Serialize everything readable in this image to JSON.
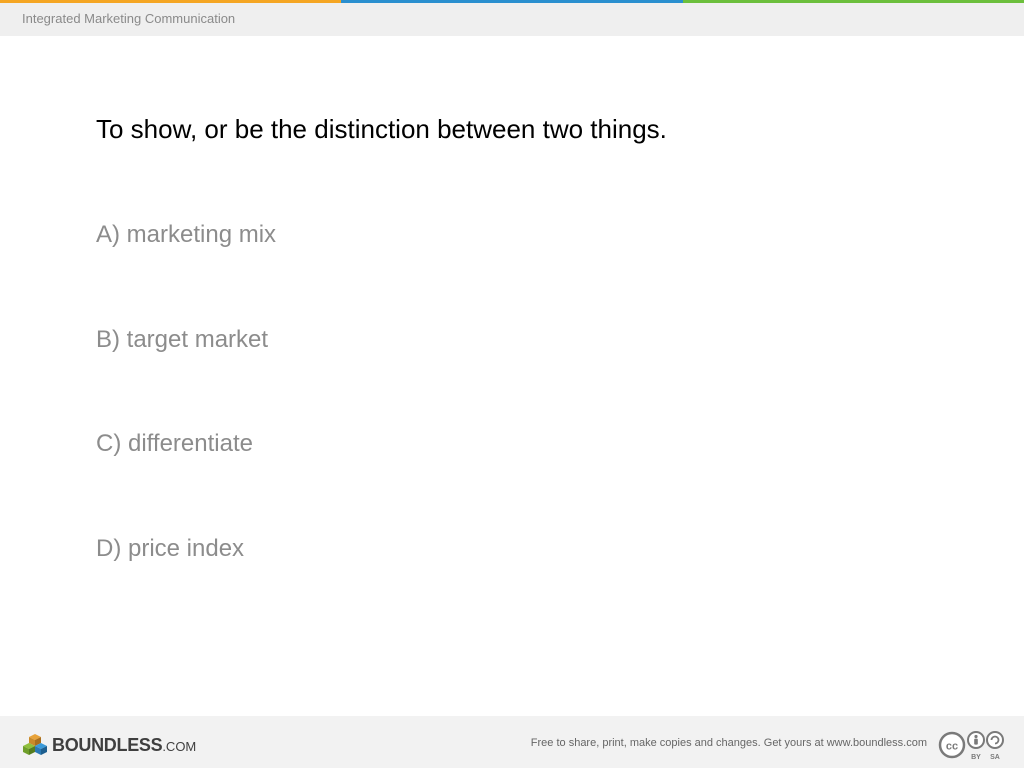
{
  "header": {
    "title": "Integrated Marketing Communication",
    "stripe_colors": [
      "#f5a623",
      "#2a8fcf",
      "#6cbf3c"
    ]
  },
  "question": {
    "prompt": "To show, or be the distinction between two things.",
    "options": [
      "A) marketing mix",
      "B) target market",
      "C) differentiate",
      "D) price index"
    ]
  },
  "footer": {
    "logo_word": "BOUNDLESS",
    "logo_suffix": ".COM",
    "license_text": "Free to share, print, make copies and changes. Get yours at www.boundless.com",
    "license_badges": [
      "cc",
      "BY",
      "SA"
    ]
  }
}
